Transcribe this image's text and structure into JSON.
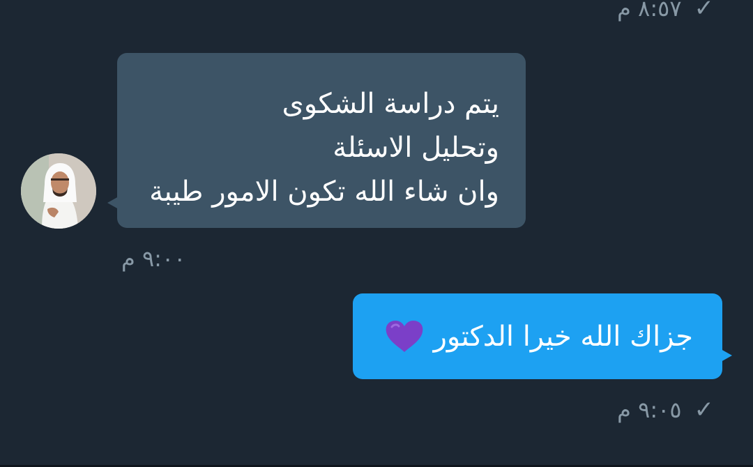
{
  "messages": [
    {
      "direction": "sent",
      "time": "٨:٥٧ م",
      "status_icon": "checkmark-icon"
    },
    {
      "direction": "received",
      "lines": [
        "يتم دراسة الشكوى",
        "وتحليل الاسئلة",
        "وان شاء الله تكون الامور طيبة"
      ],
      "time": "٩:٠٠ م",
      "avatar": "user-avatar"
    },
    {
      "direction": "sent",
      "text": "جزاك الله خيرا الدكتور",
      "emoji": "purple-heart-icon",
      "time": "٩:٠٥ م",
      "status_icon": "checkmark-icon"
    }
  ],
  "colors": {
    "background": "#1c2733",
    "received_bubble": "#3d5466",
    "sent_bubble": "#1da1f2",
    "meta_text": "#8899a6",
    "heart": "#7b3fc8"
  }
}
